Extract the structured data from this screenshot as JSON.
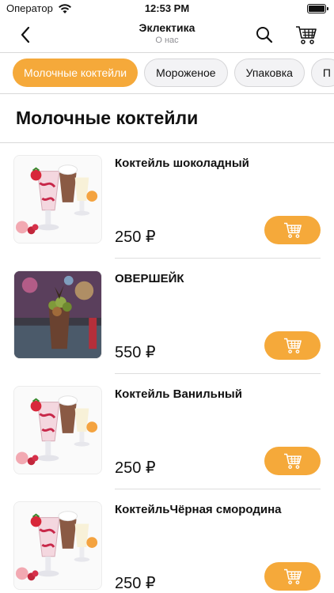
{
  "status_bar": {
    "carrier": "Оператор",
    "time": "12:53 PM"
  },
  "nav": {
    "title": "Эклектика",
    "subtitle": "О нас",
    "icons": [
      "back-chevron-icon",
      "search-icon",
      "cart-icon"
    ]
  },
  "categories": [
    {
      "label": "Молочные коктейли",
      "active": true
    },
    {
      "label": "Мороженое",
      "active": false
    },
    {
      "label": "Упаковка",
      "active": false
    },
    {
      "label": "П",
      "active": false
    }
  ],
  "section_title": "Молочные коктейли",
  "products": [
    {
      "name": "Коктейль шоколадный",
      "price": "250 ₽",
      "image": "milkshake-photo"
    },
    {
      "name": "ОВЕРШЕЙК",
      "price": "550 ₽",
      "image": "overshake-photo"
    },
    {
      "name": "Коктейль Ванильный",
      "price": "250 ₽",
      "image": "milkshake-photo"
    },
    {
      "name": "КоктейльЧёрная смородина",
      "price": "250 ₽",
      "image": "milkshake-photo"
    }
  ],
  "colors": {
    "accent": "#f5a93a",
    "chip_inactive_bg": "#f3f3f5",
    "text": "#111111",
    "subtitle": "#8e8e93"
  }
}
